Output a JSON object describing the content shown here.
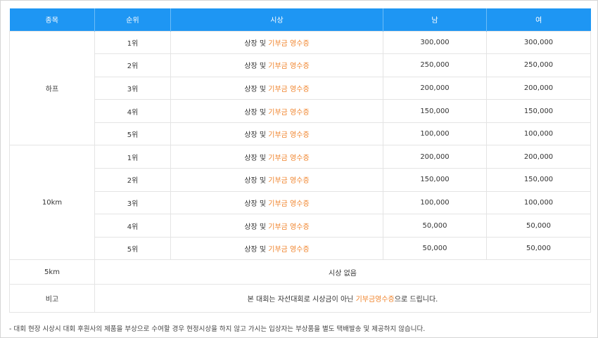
{
  "columns": [
    "종목",
    "순위",
    "시상",
    "남",
    "여"
  ],
  "award": {
    "prefix": "상장 및",
    "highlight": "기부금 영수증"
  },
  "half": {
    "event": "하프",
    "rows": [
      {
        "rank": "1위",
        "male": "300,000",
        "female": "300,000"
      },
      {
        "rank": "2위",
        "male": "250,000",
        "female": "250,000"
      },
      {
        "rank": "3위",
        "male": "200,000",
        "female": "200,000"
      },
      {
        "rank": "4위",
        "male": "150,000",
        "female": "150,000"
      },
      {
        "rank": "5위",
        "male": "100,000",
        "female": "100,000"
      }
    ]
  },
  "tenk": {
    "event": "10km",
    "rows": [
      {
        "rank": "1위",
        "male": "200,000",
        "female": "200,000"
      },
      {
        "rank": "2위",
        "male": "150,000",
        "female": "150,000"
      },
      {
        "rank": "3위",
        "male": "100,000",
        "female": "100,000"
      },
      {
        "rank": "4위",
        "male": "50,000",
        "female": "50,000"
      },
      {
        "rank": "5위",
        "male": "50,000",
        "female": "50,000"
      }
    ]
  },
  "fivek": {
    "event": "5km",
    "text": "시상 없음"
  },
  "note": {
    "label": "비고",
    "before": "본 대회는 자선대회로 시상금이 아닌",
    "highlight": "기부금영수증",
    "after": "으로 드립니다."
  },
  "footnote": "- 대회 현장 시상시 대회 후원사의 제품을 부상으로 수여할 경우 현정시상을 하지 않고 가시는 입상자는 부상품을 별도 택배발송 및 제공하지 않습니다.",
  "colors": {
    "header_bg": "#1e96f3",
    "highlight": "#f0842c",
    "border": "#e4e4e4"
  }
}
